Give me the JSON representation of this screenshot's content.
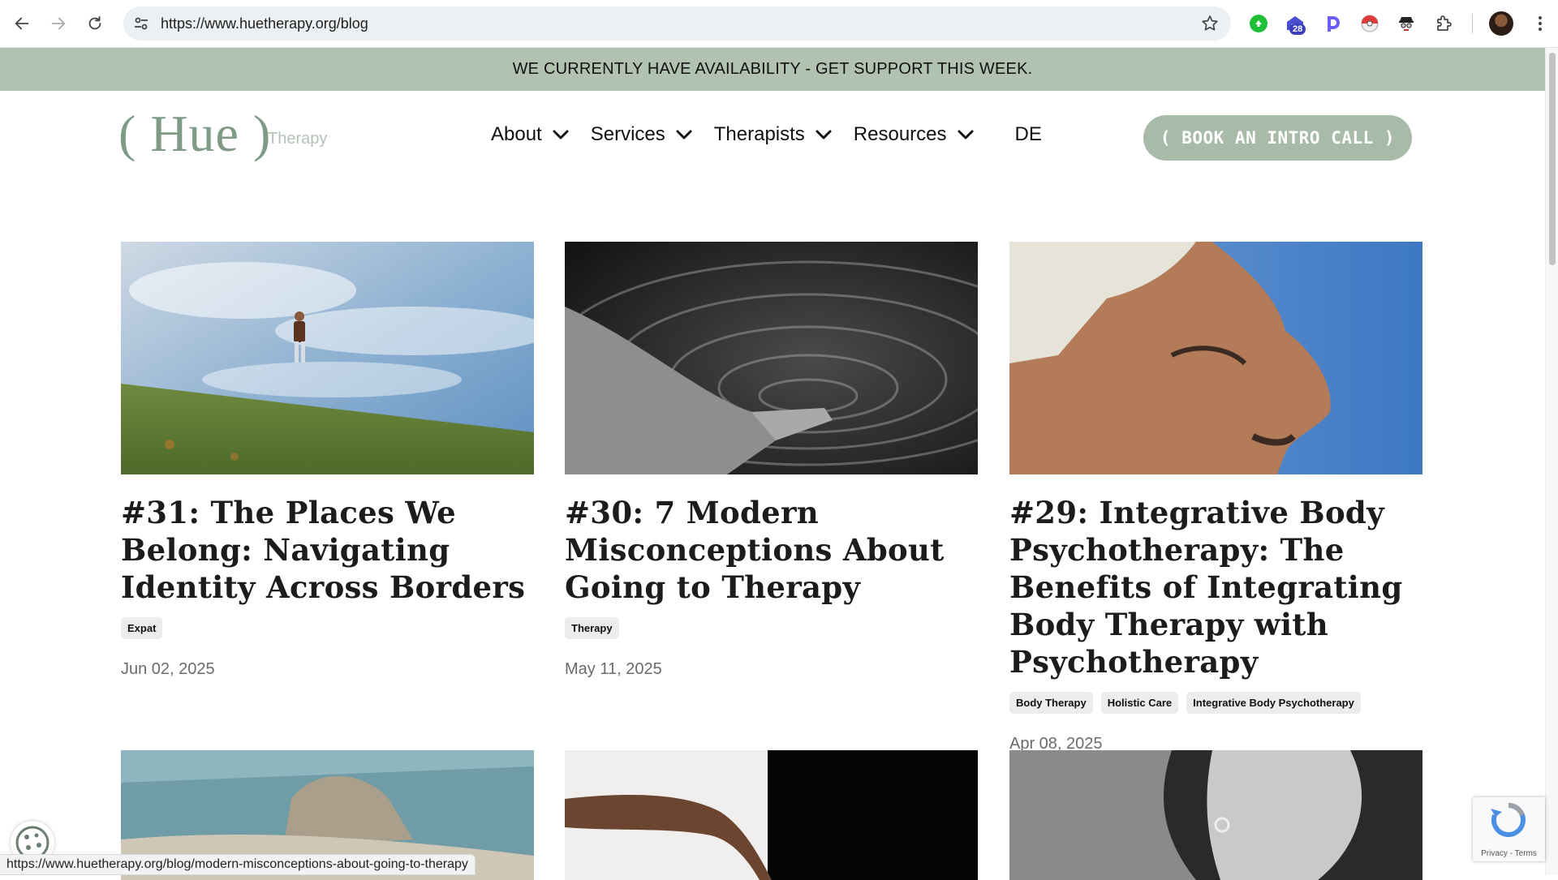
{
  "browser": {
    "url": "https://www.huetherapy.org/blog",
    "extension_badge": "28",
    "status_url": "https://www.huetherapy.org/blog/modern-misconceptions-about-going-to-therapy"
  },
  "banner": {
    "text": "WE CURRENTLY HAVE AVAILABILITY - GET SUPPORT THIS WEEK."
  },
  "header": {
    "logo": "( Hue )",
    "logo_sub": "Therapy",
    "nav": [
      {
        "label": "About"
      },
      {
        "label": "Services"
      },
      {
        "label": "Therapists"
      },
      {
        "label": "Resources"
      }
    ],
    "lang": "DE",
    "cta": "( BOOK AN INTRO CALL )"
  },
  "posts": [
    {
      "title": "#31: The Places We Belong: Navigating Identity Across Borders",
      "tags": [
        "Expat"
      ],
      "date": "Jun 02, 2025"
    },
    {
      "title": "#30: 7 Modern Misconceptions About Going to Therapy",
      "tags": [
        "Therapy"
      ],
      "date": "May 11, 2025"
    },
    {
      "title": "#29: Integrative Body Psychotherapy: The Benefits of Integrating Body Therapy with Psychotherapy",
      "tags": [
        "Body Therapy",
        "Holistic Care",
        "Integrative Body Psychotherapy"
      ],
      "date": "Apr 08, 2025"
    }
  ],
  "recaptcha": {
    "links": "Privacy - Terms"
  },
  "colors": {
    "banner": "#b1c2b1",
    "accent": "#7f9a86",
    "cta": "#a8bba9"
  }
}
